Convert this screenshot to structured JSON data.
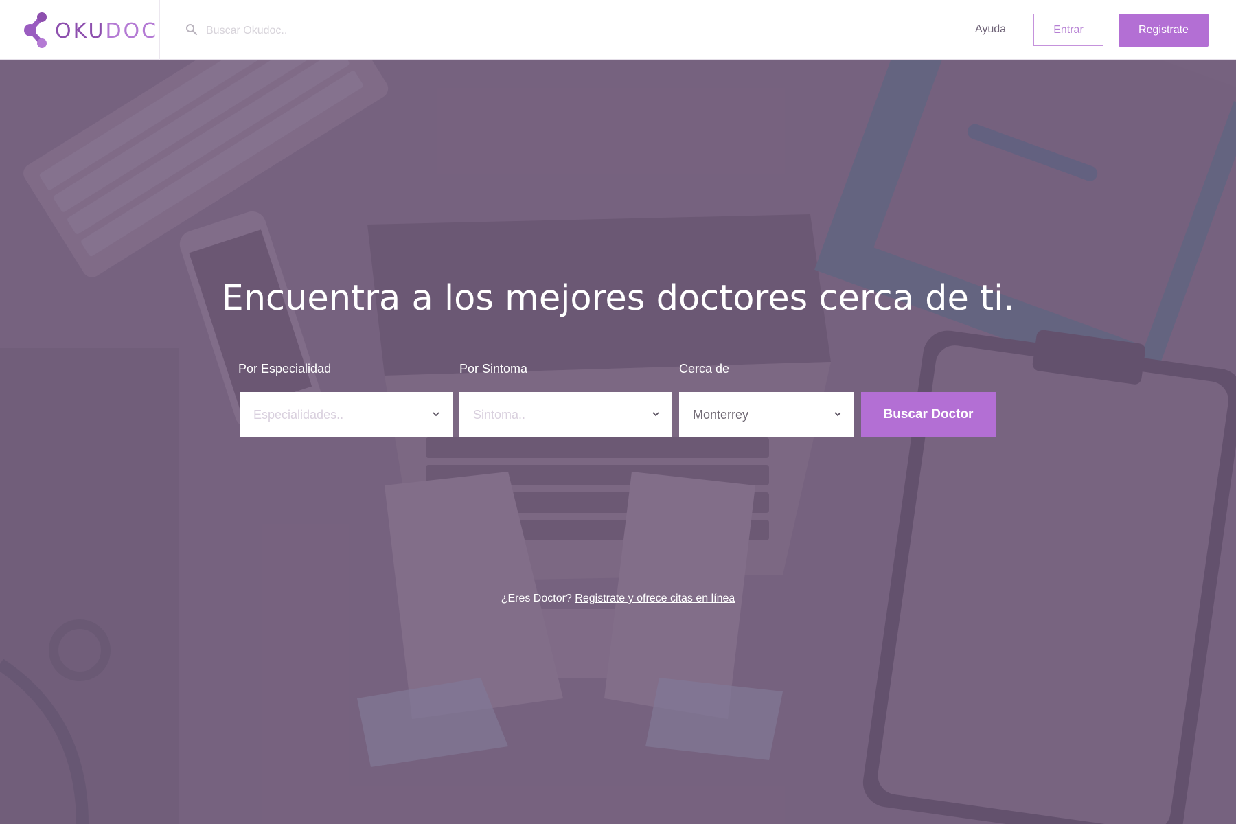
{
  "brand": {
    "name_dark": "OKU",
    "name_light": "DOC",
    "colors": {
      "primary": "#b36fd4",
      "logo": "#8d4fae",
      "overlay": "#7a6681"
    }
  },
  "header": {
    "search_placeholder": "Buscar Okudoc..",
    "help_label": "Ayuda",
    "login_label": "Entrar",
    "register_label": "Registrate"
  },
  "hero": {
    "title": "Encuentra a los mejores doctores cerca de ti.",
    "filters": [
      {
        "label": "Por Especialidad",
        "placeholder": "Especialidades.."
      },
      {
        "label": "Por Sintoma",
        "placeholder": "Sintoma.."
      },
      {
        "label": "Cerca de",
        "value": "Monterrey"
      }
    ],
    "search_button": "Buscar Doctor",
    "doctor_prompt": "¿Eres Doctor?",
    "doctor_link": "Registrate y ofrece citas en línea"
  },
  "icons": {
    "search": "search-icon",
    "chevron": "chevron-down-icon",
    "logo": "okudoc-logo-icon"
  }
}
